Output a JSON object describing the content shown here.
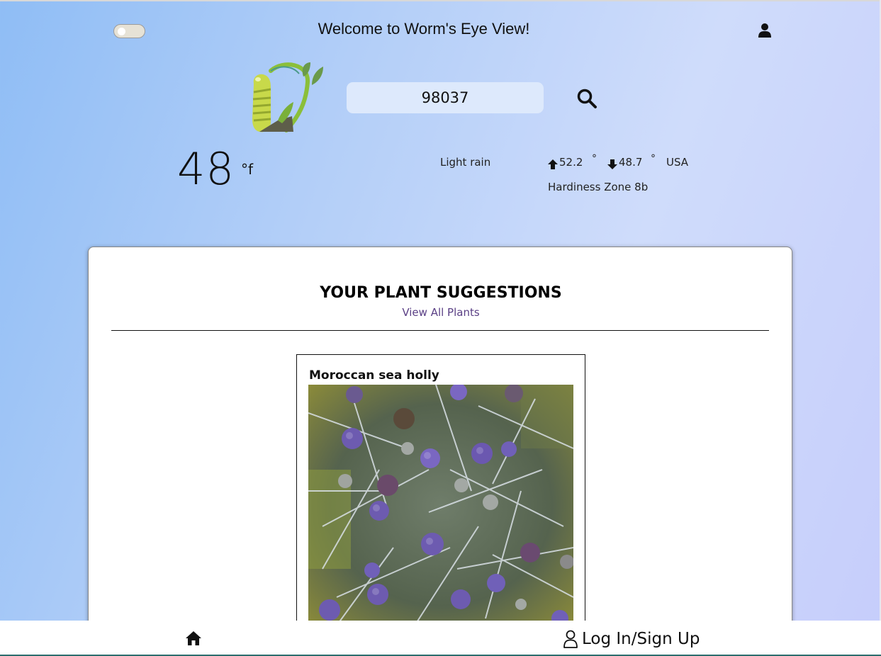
{
  "header": {
    "welcome": "Welcome to Worm's Eye View!",
    "theme_toggle": "off",
    "user_icon": "user-icon"
  },
  "search": {
    "value": "98037",
    "icon": "search-icon"
  },
  "weather": {
    "temperature": "48",
    "unit": "°f",
    "condition": "Light rain",
    "high": "52.2",
    "low": "48.7",
    "degree": "°",
    "country": "USA",
    "zone": "Hardiness Zone 8b"
  },
  "suggestions": {
    "title": "YOUR PLANT SUGGESTIONS",
    "view_all": "View All Plants",
    "plants": [
      {
        "name": "Moroccan sea holly"
      }
    ]
  },
  "bottom_nav": {
    "home_icon": "home-icon",
    "login_label": "Log In/Sign Up"
  },
  "colors": {
    "link": "#5a3f85",
    "search_bg": "#dde9fc",
    "footer_border": "#2c6e6e"
  }
}
